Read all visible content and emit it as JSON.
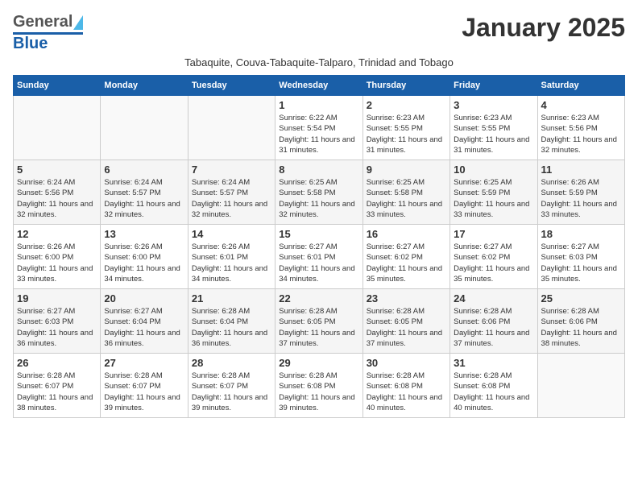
{
  "header": {
    "logo_general": "General",
    "logo_blue": "Blue",
    "month_title": "January 2025",
    "subtitle": "Tabaquite, Couva-Tabaquite-Talparo, Trinidad and Tobago"
  },
  "days_of_week": [
    "Sunday",
    "Monday",
    "Tuesday",
    "Wednesday",
    "Thursday",
    "Friday",
    "Saturday"
  ],
  "weeks": [
    [
      {
        "day": "",
        "info": ""
      },
      {
        "day": "",
        "info": ""
      },
      {
        "day": "",
        "info": ""
      },
      {
        "day": "1",
        "info": "Sunrise: 6:22 AM\nSunset: 5:54 PM\nDaylight: 11 hours and 31 minutes."
      },
      {
        "day": "2",
        "info": "Sunrise: 6:23 AM\nSunset: 5:55 PM\nDaylight: 11 hours and 31 minutes."
      },
      {
        "day": "3",
        "info": "Sunrise: 6:23 AM\nSunset: 5:55 PM\nDaylight: 11 hours and 31 minutes."
      },
      {
        "day": "4",
        "info": "Sunrise: 6:23 AM\nSunset: 5:56 PM\nDaylight: 11 hours and 32 minutes."
      }
    ],
    [
      {
        "day": "5",
        "info": "Sunrise: 6:24 AM\nSunset: 5:56 PM\nDaylight: 11 hours and 32 minutes."
      },
      {
        "day": "6",
        "info": "Sunrise: 6:24 AM\nSunset: 5:57 PM\nDaylight: 11 hours and 32 minutes."
      },
      {
        "day": "7",
        "info": "Sunrise: 6:24 AM\nSunset: 5:57 PM\nDaylight: 11 hours and 32 minutes."
      },
      {
        "day": "8",
        "info": "Sunrise: 6:25 AM\nSunset: 5:58 PM\nDaylight: 11 hours and 32 minutes."
      },
      {
        "day": "9",
        "info": "Sunrise: 6:25 AM\nSunset: 5:58 PM\nDaylight: 11 hours and 33 minutes."
      },
      {
        "day": "10",
        "info": "Sunrise: 6:25 AM\nSunset: 5:59 PM\nDaylight: 11 hours and 33 minutes."
      },
      {
        "day": "11",
        "info": "Sunrise: 6:26 AM\nSunset: 5:59 PM\nDaylight: 11 hours and 33 minutes."
      }
    ],
    [
      {
        "day": "12",
        "info": "Sunrise: 6:26 AM\nSunset: 6:00 PM\nDaylight: 11 hours and 33 minutes."
      },
      {
        "day": "13",
        "info": "Sunrise: 6:26 AM\nSunset: 6:00 PM\nDaylight: 11 hours and 34 minutes."
      },
      {
        "day": "14",
        "info": "Sunrise: 6:26 AM\nSunset: 6:01 PM\nDaylight: 11 hours and 34 minutes."
      },
      {
        "day": "15",
        "info": "Sunrise: 6:27 AM\nSunset: 6:01 PM\nDaylight: 11 hours and 34 minutes."
      },
      {
        "day": "16",
        "info": "Sunrise: 6:27 AM\nSunset: 6:02 PM\nDaylight: 11 hours and 35 minutes."
      },
      {
        "day": "17",
        "info": "Sunrise: 6:27 AM\nSunset: 6:02 PM\nDaylight: 11 hours and 35 minutes."
      },
      {
        "day": "18",
        "info": "Sunrise: 6:27 AM\nSunset: 6:03 PM\nDaylight: 11 hours and 35 minutes."
      }
    ],
    [
      {
        "day": "19",
        "info": "Sunrise: 6:27 AM\nSunset: 6:03 PM\nDaylight: 11 hours and 36 minutes."
      },
      {
        "day": "20",
        "info": "Sunrise: 6:27 AM\nSunset: 6:04 PM\nDaylight: 11 hours and 36 minutes."
      },
      {
        "day": "21",
        "info": "Sunrise: 6:28 AM\nSunset: 6:04 PM\nDaylight: 11 hours and 36 minutes."
      },
      {
        "day": "22",
        "info": "Sunrise: 6:28 AM\nSunset: 6:05 PM\nDaylight: 11 hours and 37 minutes."
      },
      {
        "day": "23",
        "info": "Sunrise: 6:28 AM\nSunset: 6:05 PM\nDaylight: 11 hours and 37 minutes."
      },
      {
        "day": "24",
        "info": "Sunrise: 6:28 AM\nSunset: 6:06 PM\nDaylight: 11 hours and 37 minutes."
      },
      {
        "day": "25",
        "info": "Sunrise: 6:28 AM\nSunset: 6:06 PM\nDaylight: 11 hours and 38 minutes."
      }
    ],
    [
      {
        "day": "26",
        "info": "Sunrise: 6:28 AM\nSunset: 6:07 PM\nDaylight: 11 hours and 38 minutes."
      },
      {
        "day": "27",
        "info": "Sunrise: 6:28 AM\nSunset: 6:07 PM\nDaylight: 11 hours and 39 minutes."
      },
      {
        "day": "28",
        "info": "Sunrise: 6:28 AM\nSunset: 6:07 PM\nDaylight: 11 hours and 39 minutes."
      },
      {
        "day": "29",
        "info": "Sunrise: 6:28 AM\nSunset: 6:08 PM\nDaylight: 11 hours and 39 minutes."
      },
      {
        "day": "30",
        "info": "Sunrise: 6:28 AM\nSunset: 6:08 PM\nDaylight: 11 hours and 40 minutes."
      },
      {
        "day": "31",
        "info": "Sunrise: 6:28 AM\nSunset: 6:08 PM\nDaylight: 11 hours and 40 minutes."
      },
      {
        "day": "",
        "info": ""
      }
    ]
  ]
}
